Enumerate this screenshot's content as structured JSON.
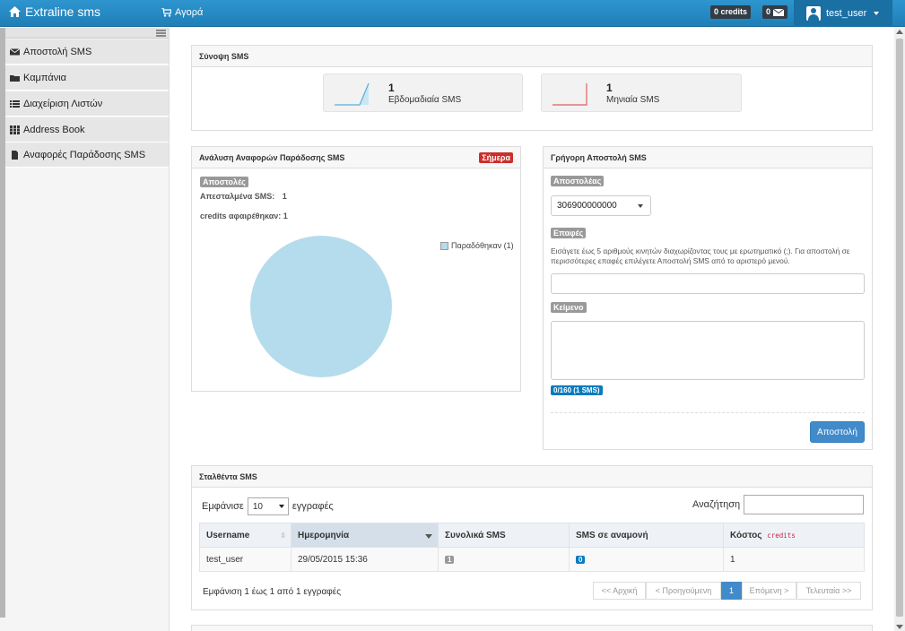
{
  "topbar": {
    "brand": "Extraline sms",
    "shop": "Αγορά",
    "credits_badge": "0 credits",
    "messages_badge": "0",
    "username": "test_user"
  },
  "sidebar": {
    "items": [
      {
        "label": "Αποστολή SMS",
        "icon": "envelope-icon"
      },
      {
        "label": "Καμπάνια",
        "icon": "folder-icon"
      },
      {
        "label": "Διαχείριση Λιστών",
        "icon": "list-icon"
      },
      {
        "label": "Address Book",
        "icon": "grid-icon"
      },
      {
        "label": "Αναφορές Παράδοσης SMS",
        "icon": "file-icon"
      }
    ]
  },
  "summary": {
    "title": "Σύνοψη SMS",
    "weekly": {
      "value": "1",
      "label": "Εβδομαδιαία SMS"
    },
    "monthly": {
      "value": "1",
      "label": "Μηνιαία SMS"
    }
  },
  "delivery": {
    "title": "Ανάλυση Αναφορών Παράδοσης SMS",
    "badge": "Σήμερα",
    "section_label": "Αποστολές",
    "sent_label": "Απεσταλμένα SMS:",
    "sent_value": "1",
    "credits_label": "credits αφαιρέθηκαν:",
    "credits_value": "1",
    "legend": "Παραδόθηκαν (1)"
  },
  "chart_data": {
    "type": "pie",
    "categories": [
      "Παραδόθηκαν"
    ],
    "values": [
      1
    ]
  },
  "quick": {
    "title": "Γρήγορη Αποστολή SMS",
    "sender_label": "Αποστολέας",
    "sender_value": "306900000000",
    "contacts_label": "Επαφές",
    "contacts_help": "Εισάγετε έως 5 αριθμούς κινητών διαχωρίζοντας τους με ερωτηματικό (;). Για αποστολή σε περισσότερες επαφές επιλέγετε Αποστολή SMS από το αριστερό μενού.",
    "text_label": "Κείμενο",
    "counter": "0/160 (1 SMS)",
    "send_button": "Αποστολή"
  },
  "sent": {
    "title": "Σταλθέντα SMS",
    "show_label": "Εμφάνισε",
    "page_size": "10",
    "records_label": "εγγραφές",
    "search_label": "Αναζήτηση",
    "columns": [
      "Username",
      "Ημερομηνία",
      "Συνολικά SMS",
      "SMS σε αναμονή",
      "Κόστος"
    ],
    "cost_unit": "credits",
    "rows": [
      {
        "username": "test_user",
        "date": "29/05/2015 15:36",
        "total": "1",
        "pending": "0",
        "cost": "1"
      }
    ],
    "info": "Εμφάνιση 1 έως 1 από 1 εγγραφές",
    "pagination": {
      "first": "<< Αρχική",
      "prev": "< Προηγούμενη",
      "current": "1",
      "next": "Επόμενη >",
      "last": "Τελευταία >>"
    }
  },
  "colors": {
    "brand": "#2e95cf",
    "pie": "#b5dcec",
    "primary": "#428bca",
    "danger": "#c9302c",
    "counter": "#0a7bbd"
  }
}
